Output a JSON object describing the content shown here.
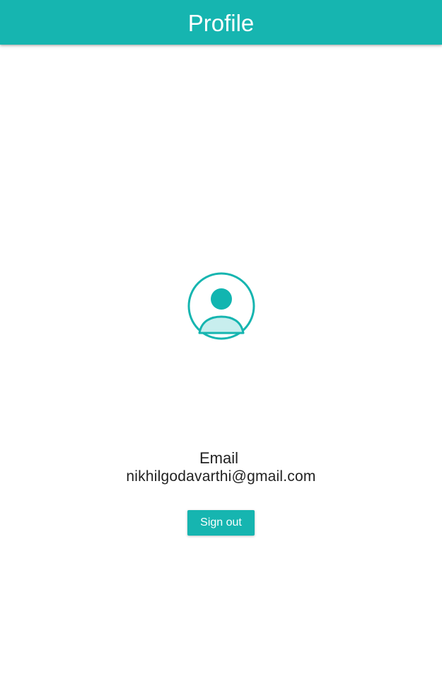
{
  "header": {
    "title": "Profile"
  },
  "profile": {
    "avatar_icon": "user-avatar-icon",
    "email_label": "Email",
    "email_value": "nikhilgodavarthi@gmail.com"
  },
  "actions": {
    "sign_out_label": "Sign out"
  },
  "colors": {
    "accent": "#16b5b0",
    "avatar_light": "#c8eeee",
    "text": "#222222",
    "background": "#ffffff"
  }
}
